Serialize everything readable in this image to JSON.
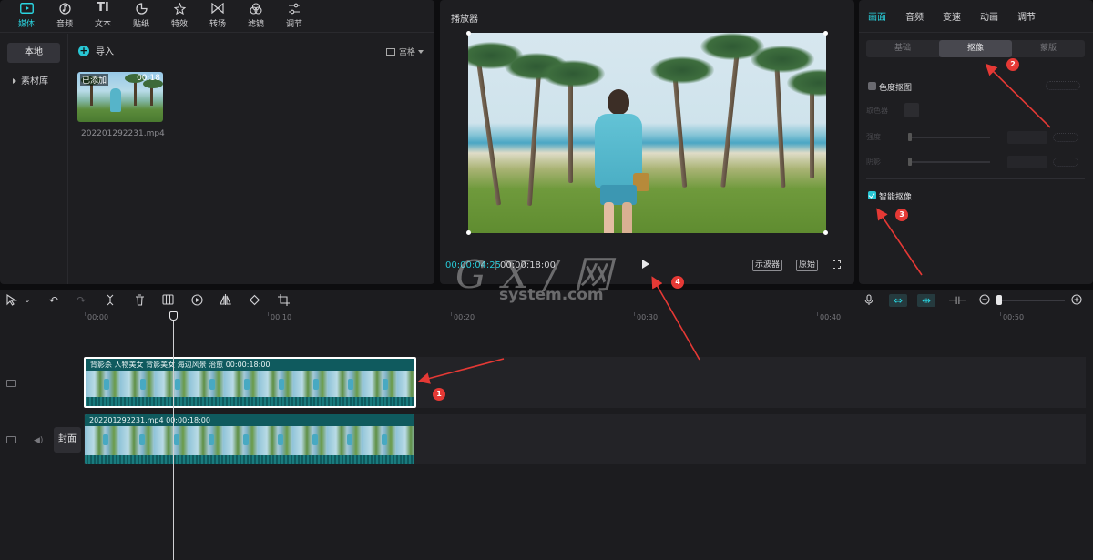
{
  "media": {
    "tabs": [
      {
        "label": "媒体",
        "icon": "media-icon"
      },
      {
        "label": "音频",
        "icon": "audio-icon"
      },
      {
        "label": "文本",
        "icon": "text-icon"
      },
      {
        "label": "贴纸",
        "icon": "sticker-icon"
      },
      {
        "label": "特效",
        "icon": "effects-icon"
      },
      {
        "label": "转场",
        "icon": "transition-icon"
      },
      {
        "label": "滤镜",
        "icon": "filter-icon"
      },
      {
        "label": "调节",
        "icon": "adjust-icon"
      }
    ],
    "sidebar": [
      {
        "label": "本地"
      },
      {
        "label": "素材库"
      }
    ],
    "import_label": "导入",
    "view_label": "宫格",
    "thumb": {
      "added_label": "已添加",
      "duration": "00:18",
      "filename": "202201292231.mp4"
    }
  },
  "player": {
    "title": "播放器",
    "time_current": "00:00:04:25",
    "time_separator": "|",
    "time_total": "00:00:18:00",
    "oscilloscope_label": "示波器",
    "original_label": "原始"
  },
  "props": {
    "tabs": [
      {
        "label": "画面"
      },
      {
        "label": "音频"
      },
      {
        "label": "变速"
      },
      {
        "label": "动画"
      },
      {
        "label": "调节"
      }
    ],
    "subtabs": [
      {
        "label": "基础"
      },
      {
        "label": "抠像"
      },
      {
        "label": "蒙版"
      }
    ],
    "chroma_key_label": "色度抠图",
    "picker_label": "取色器",
    "intensity_label": "强度",
    "shadow_label": "阴影",
    "smart_cutout_label": "智能抠像"
  },
  "timeline": {
    "ruler": [
      "00:00",
      "00:10",
      "00:20",
      "00:30",
      "00:40",
      "00:50"
    ],
    "clip_top_label": "背影杀 人物美女  背影美女 海边风景 治愈    00:00:18:00",
    "clip_bottom_label": "202201292231.mp4    00:00:18:00",
    "cover_label": "封面"
  },
  "annotations": [
    "1",
    "2",
    "3",
    "4"
  ],
  "watermark": {
    "main": "G X / 网",
    "sub": "system.com"
  },
  "colors": {
    "accent": "#2ad4e0",
    "clip": "#0f5a5e",
    "annotation": "#e53935"
  }
}
